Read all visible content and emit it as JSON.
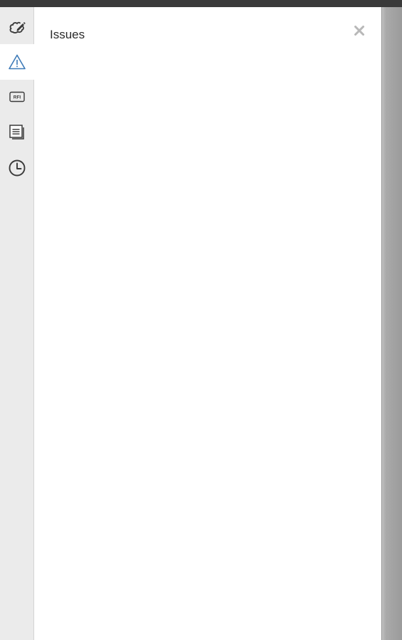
{
  "panel": {
    "title": "Issues",
    "close_icon": "close-icon"
  },
  "rail": {
    "items": [
      {
        "name": "markup",
        "icon": "cloud-pencil-icon",
        "active": false
      },
      {
        "name": "issues",
        "icon": "warning-triangle-icon",
        "active": true
      },
      {
        "name": "rfi",
        "icon": "rfi-icon",
        "label": "RFI",
        "active": false
      },
      {
        "name": "sheets",
        "icon": "document-stack-icon",
        "active": false
      },
      {
        "name": "history",
        "icon": "clock-icon",
        "active": false
      }
    ]
  },
  "colors": {
    "active_accent": "#3d7ab8",
    "icon": "#3a3a3a",
    "rail_bg": "#ebebeb",
    "close": "#b8b8b8"
  }
}
